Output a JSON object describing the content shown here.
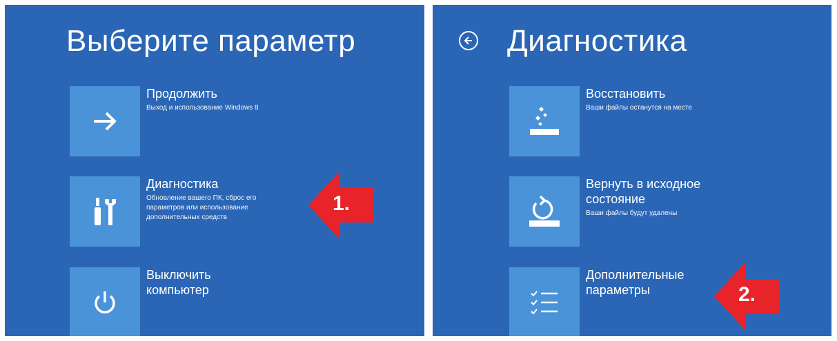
{
  "left": {
    "title": "Выберите параметр",
    "options": [
      {
        "title": "Продолжить",
        "description": "Выход и использование Windows 8",
        "icon": "arrow-right-icon"
      },
      {
        "title": "Диагностика",
        "description": "Обновление вашего ПК, сброс его параметров или использование дополнительных средств",
        "icon": "tools-icon"
      },
      {
        "title": "Выключить\nкомпьютер",
        "description": "",
        "icon": "power-icon"
      }
    ],
    "marker": "1."
  },
  "right": {
    "title": "Диагностика",
    "back_icon": "back-arrow-icon",
    "options": [
      {
        "title": "Восстановить",
        "description": "Ваши файлы останутся на месте",
        "icon": "refresh-icon"
      },
      {
        "title": "Вернуть в исходное\nсостояние",
        "description": "Ваши файлы будут удалены",
        "icon": "reset-icon"
      },
      {
        "title": "Дополнительные\nпараметры",
        "description": "",
        "icon": "checklist-icon"
      }
    ],
    "marker": "2."
  },
  "colors": {
    "background": "#2a66b5",
    "tile": "#4a93d8",
    "marker": "#e8232a",
    "text": "#ffffff"
  }
}
